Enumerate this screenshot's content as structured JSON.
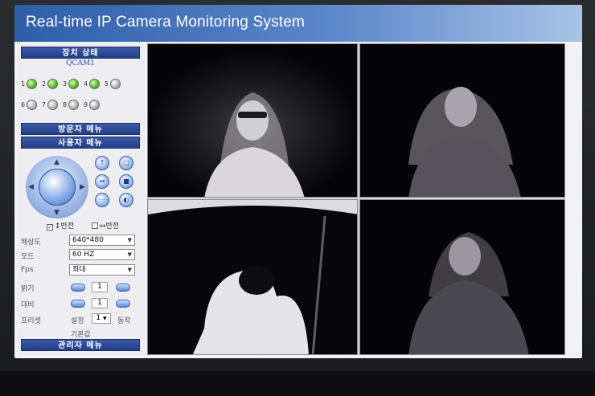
{
  "app": {
    "title": "Real-time IP Camera Monitoring System"
  },
  "sidebar": {
    "device_status_header": "장치 상태",
    "device_name": "QCAM1",
    "devices": [
      {
        "num": "1",
        "status": "on"
      },
      {
        "num": "2",
        "status": "on"
      },
      {
        "num": "3",
        "status": "on"
      },
      {
        "num": "4",
        "status": "on"
      },
      {
        "num": "5",
        "status": "off"
      },
      {
        "num": "6",
        "status": "off"
      },
      {
        "num": "7",
        "status": "off"
      },
      {
        "num": "8",
        "status": "off"
      },
      {
        "num": "9",
        "status": "off"
      }
    ],
    "visitor_menu": "방문자 메뉴",
    "user_menu": "사용자 메뉴",
    "flip_vertical": "↕반전",
    "flip_horizontal": "↔반전",
    "flip_vertical_checked": true,
    "flip_horizontal_checked": false,
    "resolution_label": "해상도",
    "resolution_value": "640*480",
    "mode_label": "모드",
    "mode_value": "60 HZ",
    "fps_label": "Fps",
    "fps_value": "최대",
    "brightness_label": "밝기",
    "brightness_value": "1",
    "contrast_label": "대비",
    "contrast_value": "1",
    "preset_label": "프리셋",
    "preset_set": "설정",
    "preset_value": "1",
    "preset_action": "동작",
    "default_label": "기본값",
    "admin_menu": "관리자 메뉴"
  },
  "icons": {
    "ptz": "ptz-joystick-icon",
    "side_buttons": [
      "zoom-in-icon",
      "zoom-out-icon",
      "focus-near-icon",
      "focus-far-icon",
      "iris-icon",
      "record-icon"
    ]
  },
  "colors": {
    "header_start": "#2f5ea8",
    "header_end": "#a9c3e6",
    "led_on": "#58c22c",
    "menu_bar": "#223f86"
  }
}
